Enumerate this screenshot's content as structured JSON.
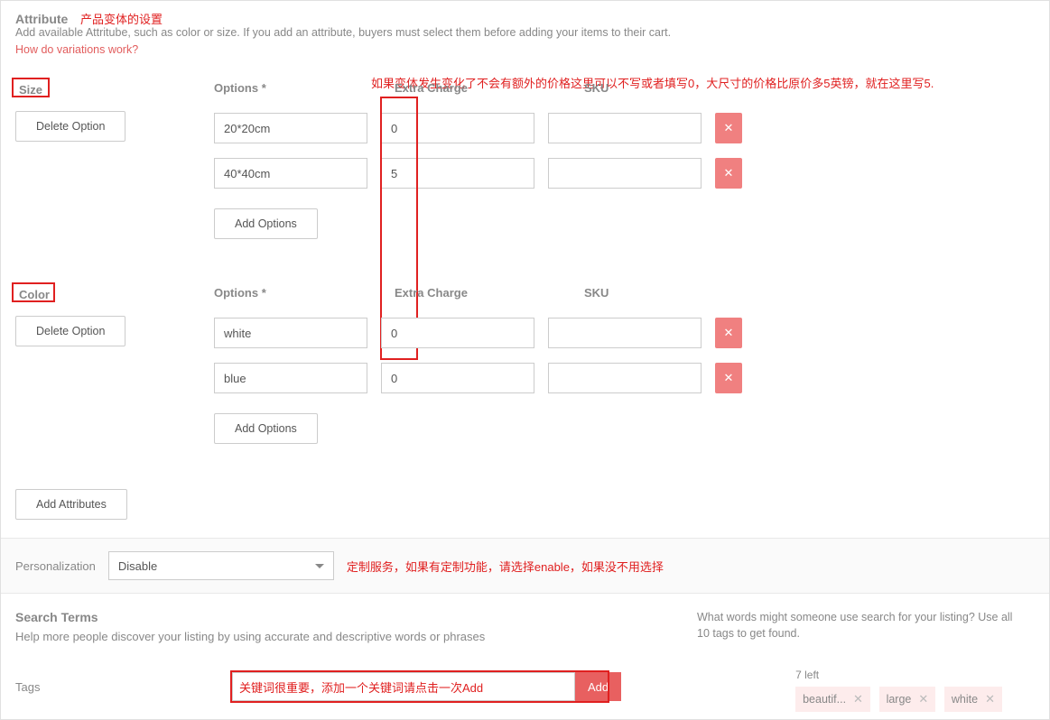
{
  "attribute": {
    "title": "Attribute",
    "annotation_title": "产品变体的设置",
    "desc": "Add available Attritube, such as color or size. If you add an attribute, buyers must select them before adding your items to their cart.",
    "link": "How do variations work?",
    "extra_charge_annotation": "如果变体发生变化了不会有额外的价格这里可以不写或者填写0，大尺寸的价格比原价多5英镑，就在这里写5.",
    "columns": {
      "options": "Options *",
      "extra_charge": "Extra Charge",
      "sku": "SKU"
    },
    "delete_option": "Delete Option",
    "add_options": "Add Options",
    "add_attributes": "Add Attributes",
    "groups": [
      {
        "name": "Size",
        "rows": [
          {
            "option": "20*20cm",
            "extra": "0",
            "sku": ""
          },
          {
            "option": "40*40cm",
            "extra": "5",
            "sku": ""
          }
        ]
      },
      {
        "name": "Color",
        "rows": [
          {
            "option": "white",
            "extra": "0",
            "sku": ""
          },
          {
            "option": "blue",
            "extra": "0",
            "sku": ""
          }
        ]
      }
    ]
  },
  "personalization": {
    "label": "Personalization",
    "value": "Disable",
    "annotation": "定制服务，如果有定制功能，请选择enable，如果没不用选择"
  },
  "search": {
    "title": "Search Terms",
    "desc": "Help more people discover your listing by using accurate and descriptive words or phrases",
    "help": "What words might someone use search for your listing? Use all 10 tags to get found.",
    "tags_label": "Tags",
    "tags_left": "7 left",
    "add": "Add",
    "input_annotation": "关键词很重要，添加一个关键词请点击一次Add",
    "chips": [
      "beautif...",
      "large",
      "white"
    ]
  }
}
